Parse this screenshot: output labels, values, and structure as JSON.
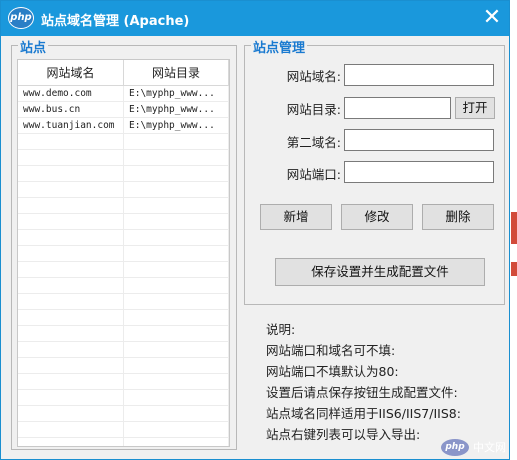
{
  "window": {
    "title": "站点域名管理 (Apache)",
    "logo_text": "php",
    "close_glyph": "✕"
  },
  "sites_group": {
    "label": "站点",
    "columns": [
      "网站域名",
      "网站目录"
    ],
    "rows": [
      [
        "www.demo.com",
        "E:\\myphp_www..."
      ],
      [
        "www.bus.cn",
        "E:\\myphp_www..."
      ],
      [
        "www.tuanjian.com",
        "E:\\myphp_www..."
      ]
    ]
  },
  "manage_group": {
    "label": "站点管理",
    "fields": {
      "domain": {
        "label": "网站域名:",
        "value": ""
      },
      "directory": {
        "label": "网站目录:",
        "value": ""
      },
      "second_domain": {
        "label": "第二域名:",
        "value": ""
      },
      "port": {
        "label": "网站端口:",
        "value": ""
      }
    },
    "open_button": "打开",
    "add_button": "新增",
    "edit_button": "修改",
    "delete_button": "删除",
    "save_button": "保存设置并生成配置文件"
  },
  "notes": [
    "说明:",
    "网站端口和域名可不填:",
    "网站端口不填默认为80:",
    "设置后请点保存按钮生成配置文件:",
    "站点域名同样适用于IIS6/IIS7/IIS8:",
    "站点右键列表可以导入导出:"
  ],
  "watermark": {
    "logo_text": "php",
    "text": "中文网"
  },
  "colors": {
    "titlebar": "#1a98dc",
    "group_title": "#1a7ad0",
    "window_bg": "#f0f0f0"
  },
  "icons": {
    "logo": "php-logo-icon",
    "close": "close-icon"
  }
}
